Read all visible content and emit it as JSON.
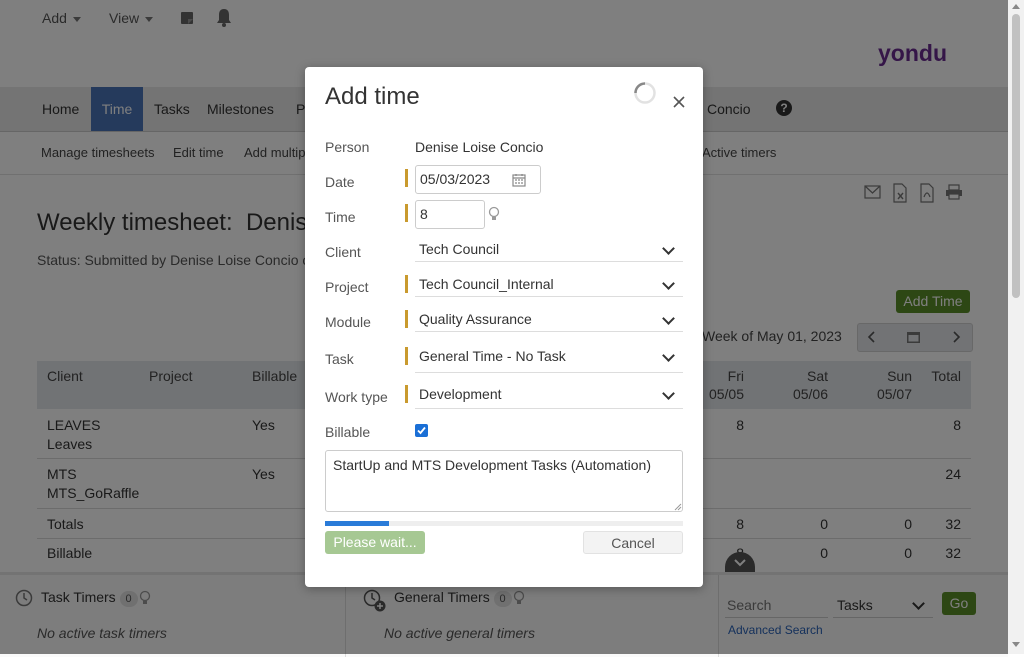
{
  "topbar": {
    "add_label": "Add",
    "view_label": "View",
    "logo_text": "yondu"
  },
  "nav": {
    "items": [
      "Home",
      "Time",
      "Tasks",
      "Milestones",
      "P"
    ],
    "user_fragment": "Concio"
  },
  "subnav": {
    "items": [
      "Manage timesheets",
      "Edit time",
      "Add multip",
      "Active timers"
    ]
  },
  "page": {
    "title": "Weekly timesheet:  Denise",
    "status": "Status: Submitted by Denise Loise Concio o",
    "add_time_button": "Add Time",
    "week_label": "Week of May 01, 2023"
  },
  "table": {
    "headers": [
      "Client",
      "Project",
      "Billable"
    ],
    "day_headers": [
      {
        "day": "Fri",
        "date": "05/05"
      },
      {
        "day": "Sat",
        "date": "05/06"
      },
      {
        "day": "Sun",
        "date": "05/07"
      }
    ],
    "total_header": "Total",
    "rows": [
      {
        "client": "LEAVES",
        "project": "Leaves",
        "billable": "Yes",
        "fri": "8",
        "sat": "",
        "sun": "",
        "total": "8"
      },
      {
        "client": "MTS",
        "project": "MTS_GoRaffle",
        "billable": "Yes",
        "fri": "",
        "sat": "",
        "sun": "",
        "total": "24"
      }
    ],
    "totals": {
      "label": "Totals",
      "fri": "8",
      "sat": "0",
      "sun": "0",
      "total": "32"
    },
    "billable": {
      "label": "Billable",
      "fri": "8",
      "sat": "0",
      "sun": "0",
      "total": "32"
    }
  },
  "bottom": {
    "task_timers_label": "Task Timers",
    "task_timers_count": "0",
    "task_timers_empty": "No active task timers",
    "general_timers_label": "General Timers",
    "general_timers_count": "0",
    "general_timers_empty": "No active general timers",
    "search_placeholder": "Search",
    "search_scope": "Tasks",
    "go_label": "Go",
    "advanced_search": "Advanced Search"
  },
  "modal": {
    "title": "Add time",
    "person_label": "Person",
    "person_value": "Denise Loise Concio",
    "date_label": "Date",
    "date_value": "05/03/2023",
    "time_label": "Time",
    "time_value": "8",
    "client_label": "Client",
    "client_value": "Tech Council",
    "project_label": "Project",
    "project_value": "Tech Council_Internal",
    "module_label": "Module",
    "module_value": "Quality Assurance",
    "task_label": "Task",
    "task_value": "General Time - No Task",
    "worktype_label": "Work type",
    "worktype_value": "Development",
    "billable_label": "Billable",
    "billable_checked": true,
    "notes_value": "StartUp and MTS Development Tasks (Automation)",
    "progress_fraction": 0.18,
    "submit_label": "Please wait...",
    "cancel_label": "Cancel"
  },
  "colors": {
    "nav_active": "#4b74b8",
    "add_time_green": "#5a8f29",
    "required_marker": "#c99a2e",
    "progress_blue": "#2a7bd8",
    "logo_purple": "#6a2c91"
  }
}
